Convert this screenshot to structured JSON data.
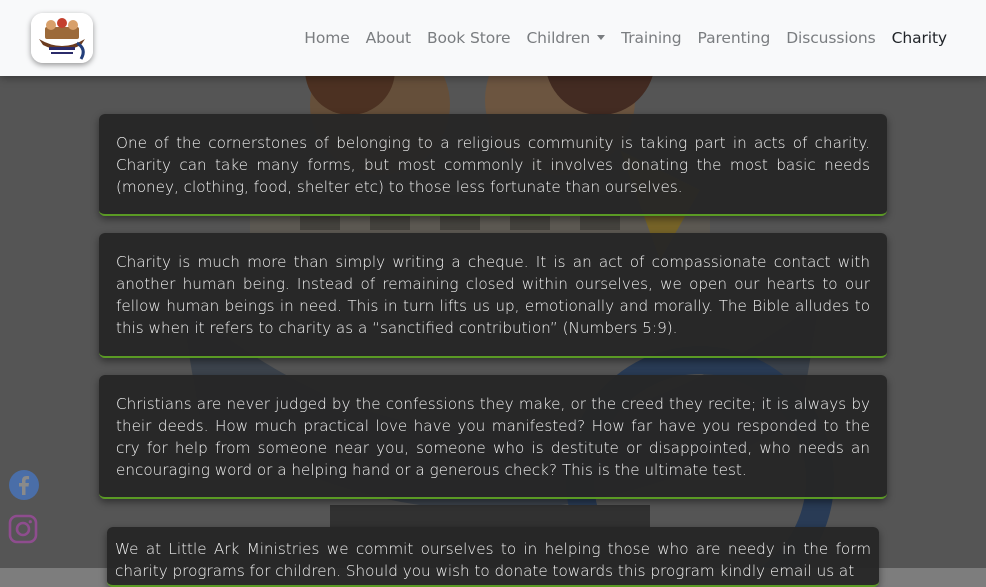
{
  "navbar": {
    "logo_alt": "Little Ark Ministries logo",
    "items": [
      {
        "label": "Home"
      },
      {
        "label": "About"
      },
      {
        "label": "Book Store"
      },
      {
        "label": "Children"
      },
      {
        "label": "Training"
      },
      {
        "label": "Parenting"
      },
      {
        "label": "Discussions"
      },
      {
        "label": "Charity"
      }
    ],
    "active": "Charity"
  },
  "content": {
    "paragraphs": [
      "One of the cornerstones of belonging to a religious community is taking part in acts of charity. Charity can take many forms, but most commonly it involves donating the most basic needs (money, clothing, food, shelter etc) to those less fortunate than ourselves.",
      "Charity is much more than simply writing a cheque. It is an act of compassionate contact with another human being. Instead of remaining closed within ourselves, we open our hearts to our fellow human beings in need. This in turn lifts us up, emotionally and morally. The Bible alludes to this when it refers to charity as a “sanctified contribution” (Numbers 5:9).",
      "Christians are never judged by the confessions they make, or the creed they recite; it is always by their deeds. How much practical love have you manifested? How far have you responded to the cry for help from someone near you, someone who is destitute or disappointed, who needs an encouraging word or a helping hand or a generous check? This is the ultimate test.",
      "We at Little Ark Ministries we commit ourselves to in helping those who are needy in the form charity programs for children. Should you wish to donate towards this program kindly email us at"
    ]
  },
  "social": {
    "icons": [
      "facebook-icon",
      "instagram-icon"
    ]
  },
  "colors": {
    "navbar_bg": "#f8f9fa",
    "nav_text": "#7a7d80",
    "nav_active": "#212529",
    "card_bg": "#262626",
    "card_accent": "#5a9a24"
  }
}
